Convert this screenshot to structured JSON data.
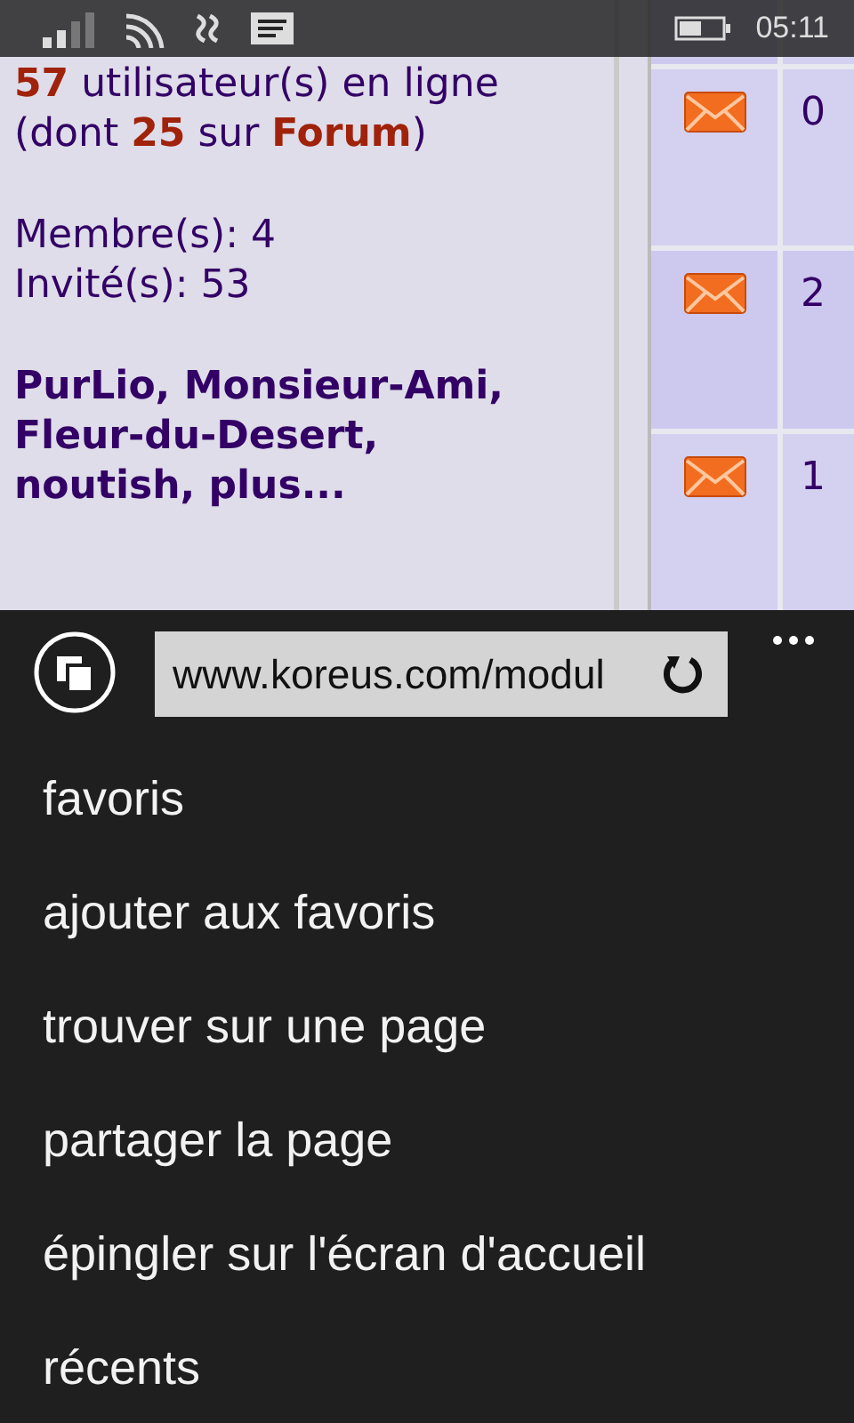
{
  "status_bar": {
    "time": "05:11"
  },
  "page": {
    "online_lines": [
      "**57** utilisateur(s) en ligne",
      "(dont **25** sur **Forum**)"
    ],
    "counts": [
      "Membre(s): 4",
      "Invité(s): 53"
    ],
    "members": "PurLio, Monsieur-Ami, Fleur-du-Desert, noutish, plus...",
    "rows": [
      {
        "column_2": "0"
      },
      {
        "column_2": "2"
      },
      {
        "column_2": "1"
      }
    ]
  },
  "address_bar": {
    "url": "www.koreus.com/modul"
  },
  "menu": [
    "favoris",
    "ajouter aux favoris",
    "trouver sur une page",
    "partager la page",
    "épingler sur l'écran d'accueil",
    "récents"
  ]
}
